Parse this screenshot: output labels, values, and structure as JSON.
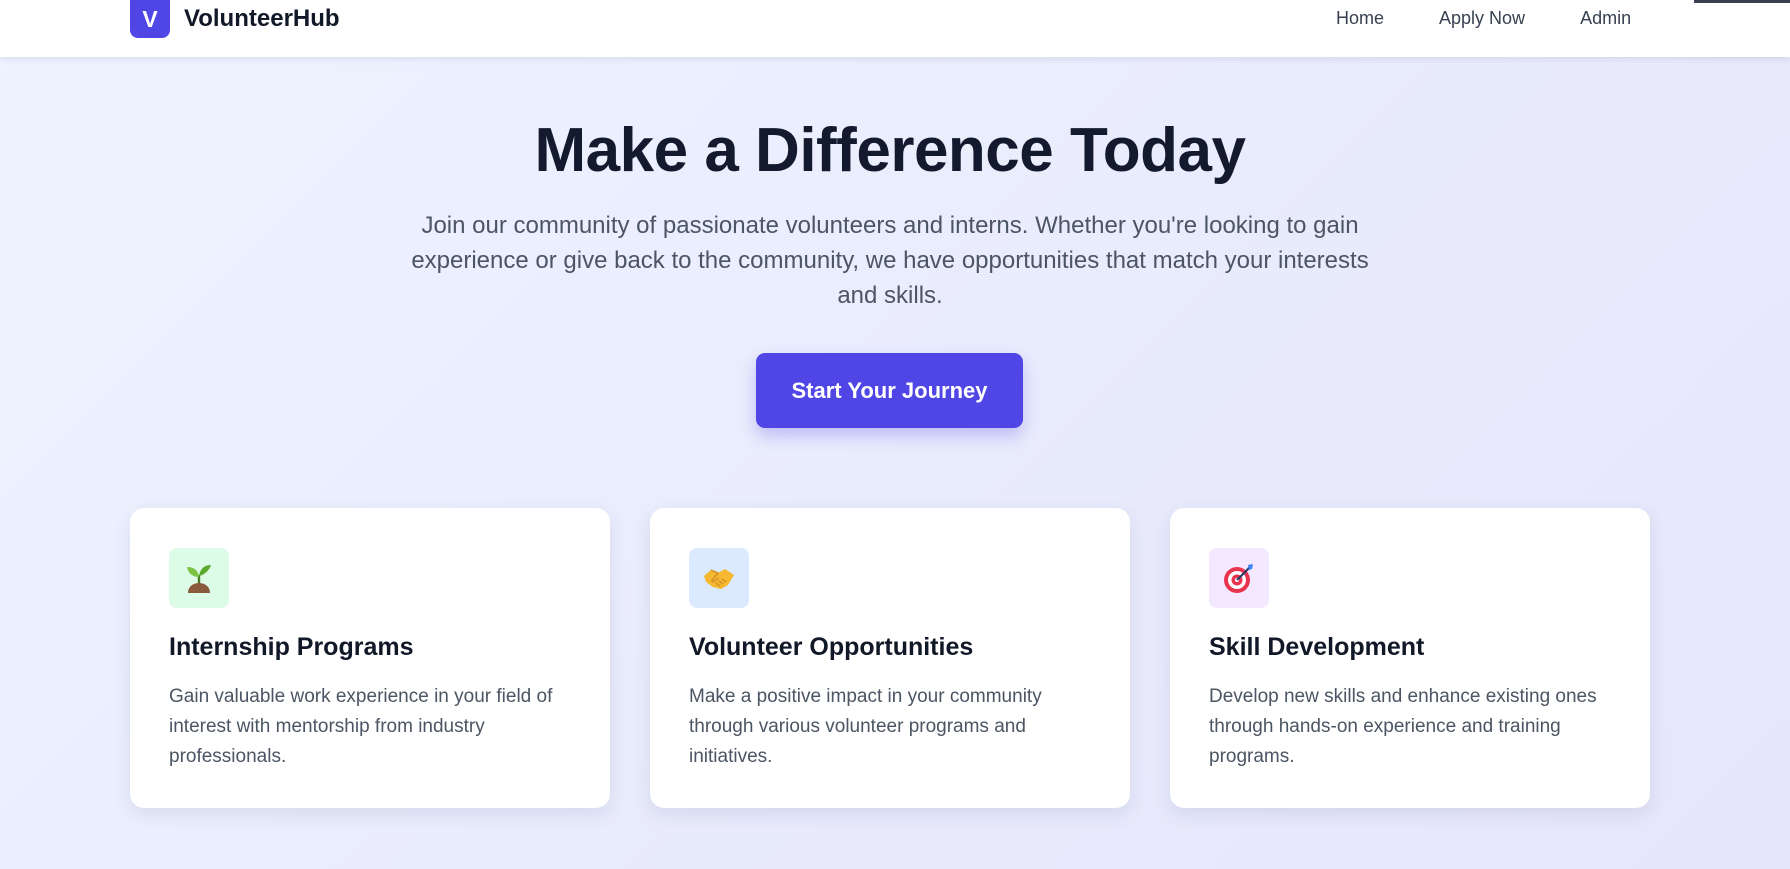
{
  "brand": {
    "logo_letter": "V",
    "name": "VolunteerHub"
  },
  "nav": {
    "links": [
      "Home",
      "Apply Now",
      "Admin"
    ]
  },
  "hero": {
    "title": "Make a Difference Today",
    "subtitle": "Join our community of passionate volunteers and interns. Whether you're looking to gain experience or give back to the community, we have opportunities that match your interests and skills.",
    "cta_label": "Start Your Journey"
  },
  "cards": [
    {
      "icon": "seedling-icon",
      "icon_bg": "#dcfce7",
      "title": "Internship Programs",
      "description": "Gain valuable work experience in your field of interest with mentorship from industry professionals."
    },
    {
      "icon": "handshake-icon",
      "icon_bg": "#dbeafe",
      "title": "Volunteer Opportunities",
      "description": "Make a positive impact in your community through various volunteer programs and initiatives."
    },
    {
      "icon": "target-icon",
      "icon_bg": "#f3e8ff",
      "title": "Skill Development",
      "description": "Develop new skills and enhance existing ones through hands-on experience and training programs."
    }
  ],
  "colors": {
    "accent": "#5046e5",
    "heading": "#131a2e",
    "body_text": "#4b5563"
  }
}
